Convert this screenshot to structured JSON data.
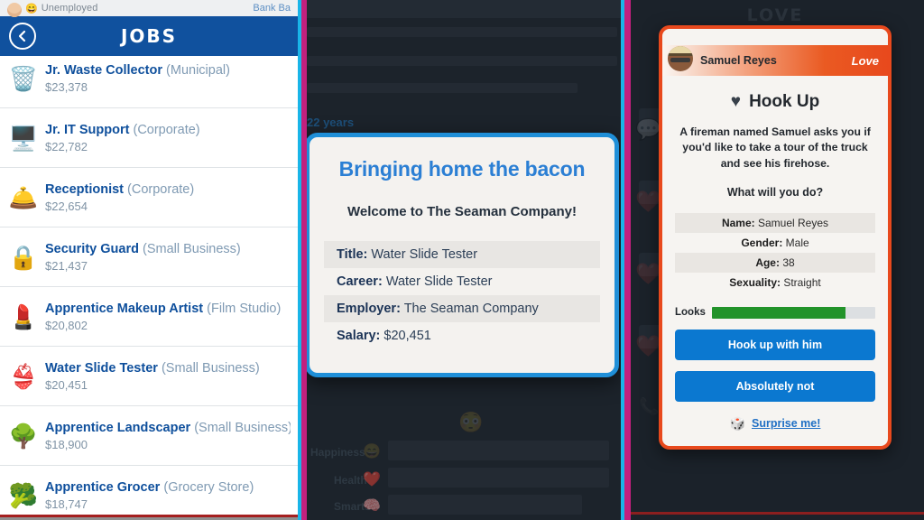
{
  "left_panel": {
    "status_bar": {
      "avatar": "person-avatar",
      "emoji": "😄",
      "status": "Unemployed",
      "right_label": "Bank Ba"
    },
    "header": {
      "back_icon": "chevron-left-icon",
      "title": "JOBS"
    },
    "jobs": [
      {
        "icon": "🗑️",
        "title": "Jr. Waste Collector",
        "employer": "(Municipal)",
        "salary": "$23,378"
      },
      {
        "icon": "🖥️",
        "title": "Jr. IT Support",
        "employer": "(Corporate)",
        "salary": "$22,782"
      },
      {
        "icon": "🛎️",
        "title": "Receptionist",
        "employer": "(Corporate)",
        "salary": "$22,654"
      },
      {
        "icon": "🔒",
        "title": "Security Guard",
        "employer": "(Small Business)",
        "salary": "$21,437"
      },
      {
        "icon": "💄",
        "title": "Apprentice Makeup Artist",
        "employer": "(Film Studio)",
        "salary": "$20,802"
      },
      {
        "icon": "👙",
        "title": "Water Slide Tester",
        "employer": "(Small Business)",
        "salary": "$20,451"
      },
      {
        "icon": "🌳",
        "title": "Apprentice Landscaper",
        "employer": "(Small Business)",
        "salary": "$18,900"
      },
      {
        "icon": "🥦",
        "title": "Apprentice Grocer",
        "employer": "(Grocery Store)",
        "salary": "$18,747"
      }
    ]
  },
  "center_panel": {
    "background": {
      "age_label": "22 years",
      "stat_labels": [
        "Happiness",
        "Health",
        "Smarts"
      ],
      "stat_icons": [
        "😄",
        "❤️",
        "🧠"
      ]
    },
    "modal": {
      "title": "Bringing home the bacon",
      "subtitle": "Welcome to The Seaman Company!",
      "details": [
        {
          "label": "Title:",
          "value": "Water Slide Tester"
        },
        {
          "label": "Career:",
          "value": "Water Slide Tester"
        },
        {
          "label": "Employer:",
          "value": "The Seaman Company"
        },
        {
          "label": "Salary:",
          "value": "$20,451"
        }
      ]
    }
  },
  "right_panel": {
    "background_title": "LOVE",
    "card": {
      "avatar": "man-with-hat-avatar",
      "person_name": "Samuel Reyes",
      "category_badge": "Love",
      "heart_icon": "heart-icon",
      "event_title": "Hook Up",
      "description": "A fireman named Samuel asks you if you'd like to take a tour of the truck and see his firehose.",
      "question": "What will you do?",
      "attributes": [
        {
          "label": "Name:",
          "value": "Samuel Reyes"
        },
        {
          "label": "Gender:",
          "value": "Male"
        },
        {
          "label": "Age:",
          "value": "38"
        },
        {
          "label": "Sexuality:",
          "value": "Straight"
        }
      ],
      "looks": {
        "label": "Looks",
        "percent": 82,
        "color": "#22932a"
      },
      "primary_button": "Hook up with him",
      "secondary_button": "Absolutely not",
      "surprise": {
        "icon": "🎲",
        "label": "Surprise me!"
      }
    }
  },
  "colors": {
    "jobs_header_blue": "#10519e",
    "modal_border_blue": "#1f8fd8",
    "card_border_orange": "#e8491d",
    "action_button_blue": "#0b78d0",
    "stripe_magenta": "#c2207e",
    "stripe_cyan": "#19b5e8"
  }
}
